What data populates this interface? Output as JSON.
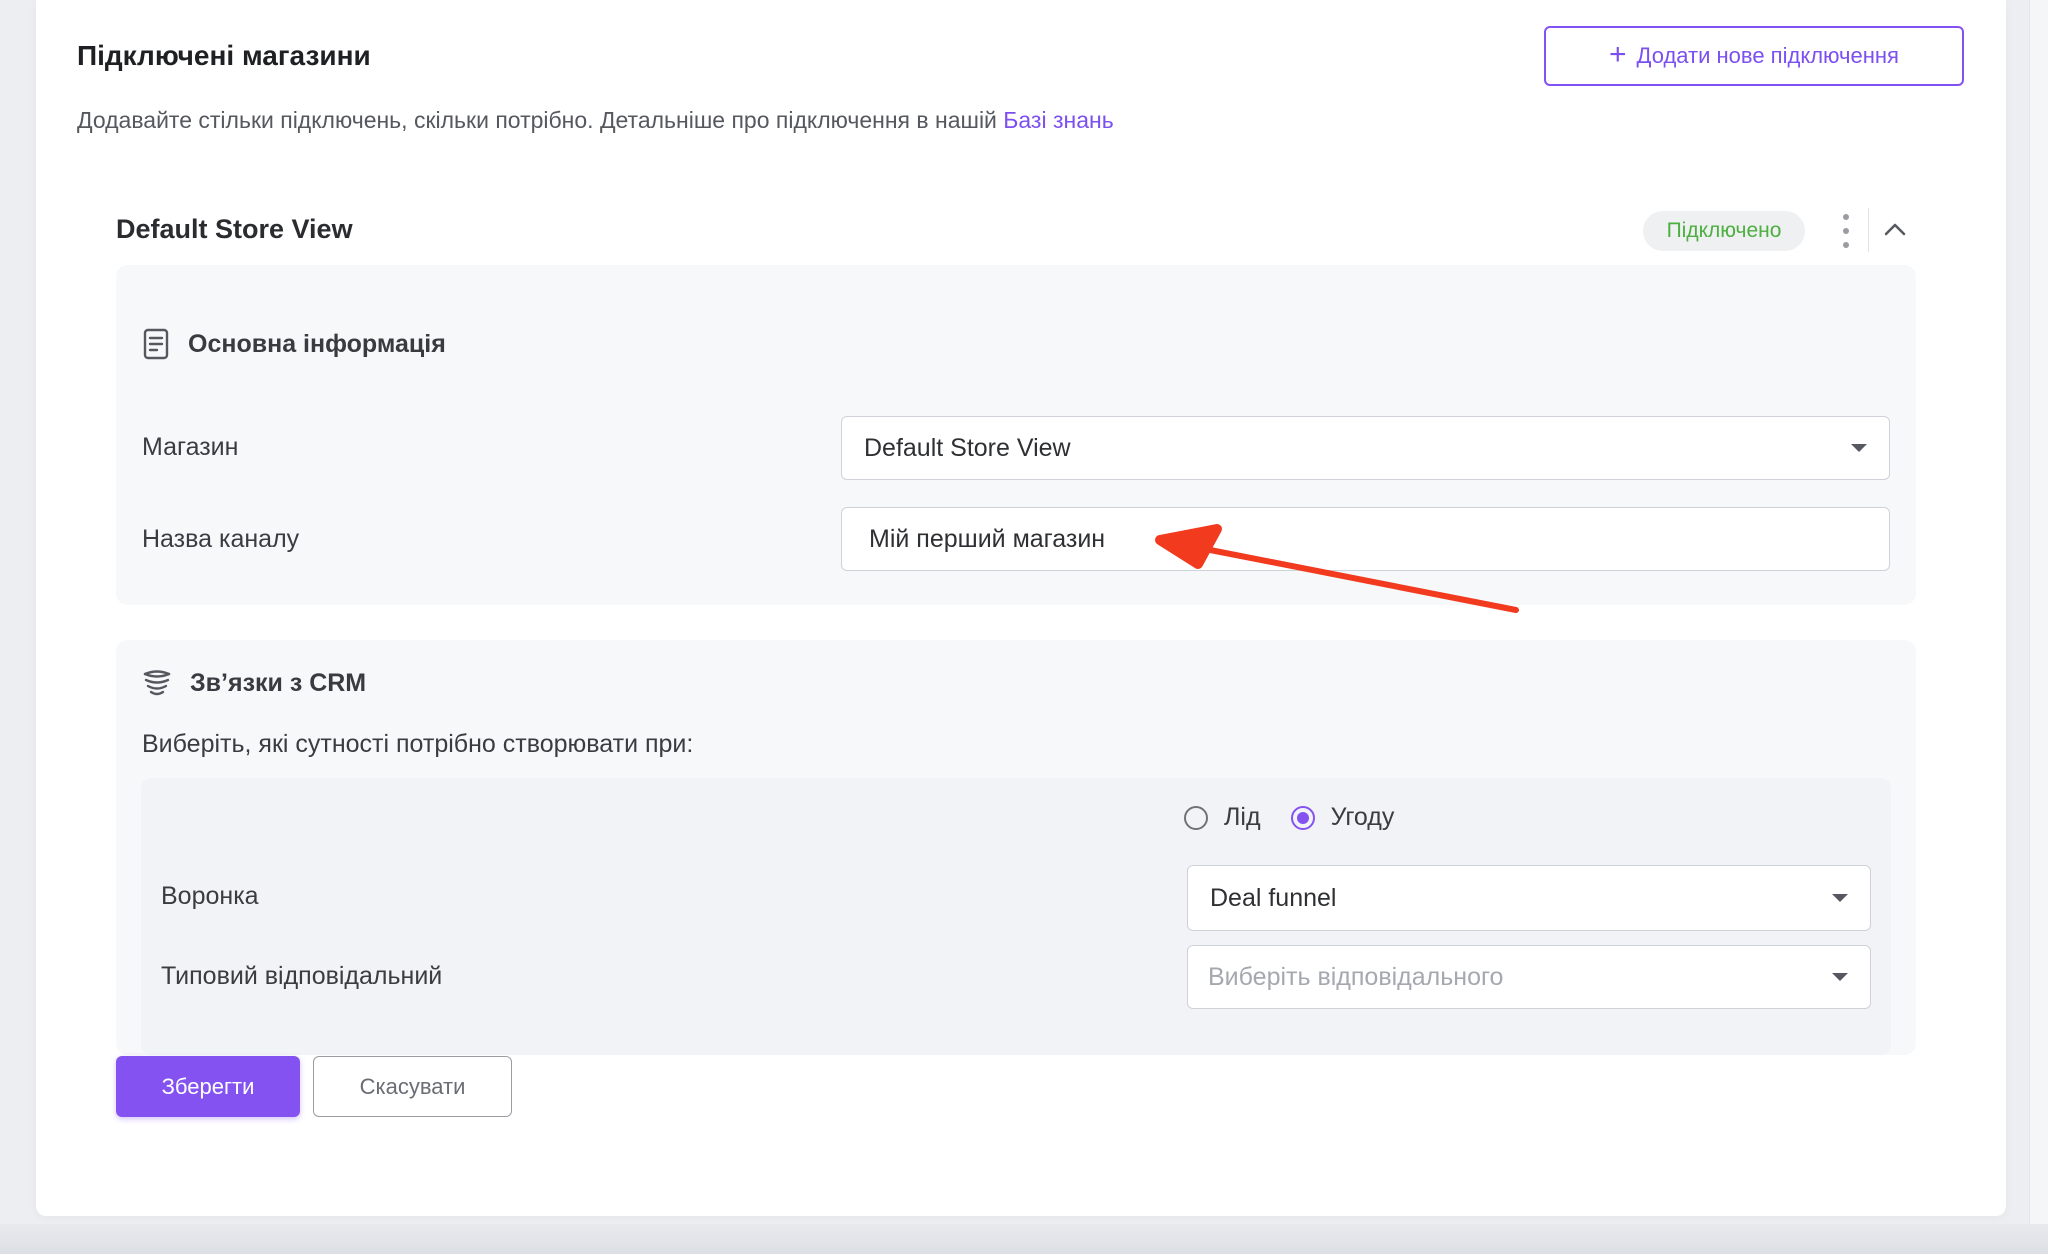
{
  "header": {
    "title": "Підключені магазини",
    "subtitle": "Додавайте стільки підключень, скільки потрібно. Детальніше про підключення в нашій ",
    "kb_link": "Базі знань",
    "add_button": "Додати нове підключення"
  },
  "store": {
    "name": "Default Store View",
    "status": "Підключено",
    "status_color": "#4caf3f"
  },
  "basic_info": {
    "title": "Основна інформація",
    "store_label": "Магазин",
    "store_value": "Default Store View",
    "channel_label": "Назва каналу",
    "channel_value": "Мій перший магазин"
  },
  "crm": {
    "title": "Зв’язки з CRM",
    "prompt": "Виберіть, які сутності потрібно створювати при:",
    "options": [
      {
        "label": "Лід",
        "checked": false
      },
      {
        "label": "Угоду",
        "checked": true
      }
    ],
    "funnel_label": "Воронка",
    "funnel_value": "Deal funnel",
    "responsible_label": "Типовий відповідальний",
    "responsible_placeholder": "Виберіть відповідального"
  },
  "actions": {
    "save": "Зберегти",
    "cancel": "Скасувати"
  },
  "colors": {
    "accent": "#8552f2",
    "annotation_arrow": "#f23a1f"
  }
}
